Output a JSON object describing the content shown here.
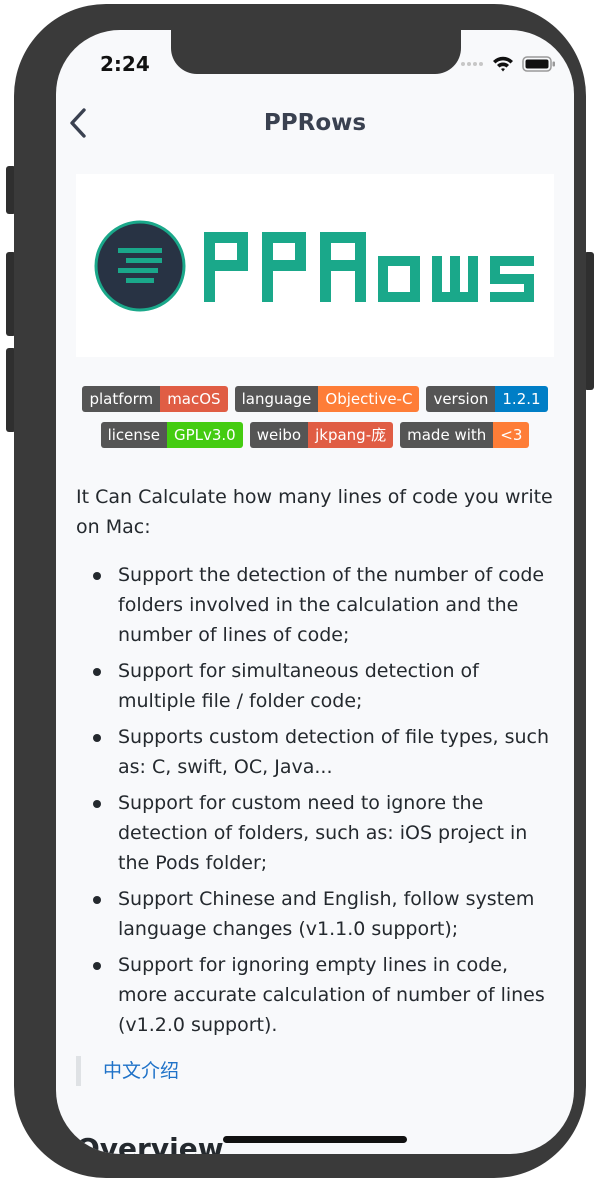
{
  "status": {
    "time": "2:24"
  },
  "nav": {
    "title": "PPRows"
  },
  "logo": {
    "text": "PPRows"
  },
  "badges_row1": [
    {
      "key": "platform",
      "value": "macOS",
      "color": "#e05d44"
    },
    {
      "key": "language",
      "value": "Objective-C",
      "color": "#fe7d37"
    },
    {
      "key": "version",
      "value": "1.2.1",
      "color": "#007ec6"
    }
  ],
  "badges_row2": [
    {
      "key": "license",
      "value": "GPLv3.0",
      "color": "#4c1"
    },
    {
      "key": "weibo",
      "value": "jkpang-庞",
      "color": "#e05d44"
    },
    {
      "key": "made with",
      "value": "<3",
      "color": "#fe7d37"
    }
  ],
  "content": {
    "intro": "It Can Calculate how many lines of code you write on Mac:",
    "features": [
      "Support the detection of the number of code folders involved in the calculation and the number of lines of code;",
      "Support for simultaneous detection of multiple file / folder code;",
      "Supports custom detection of file types, such as: C, swift, OC, Java...",
      "Support for custom need to ignore the detection of folders, such as: iOS project in the Pods folder;",
      "Support Chinese and English, follow system language changes (v1.1.0 support);",
      "Support for ignoring empty lines in code, more accurate calculation of number of lines (v1.2.0 support)."
    ],
    "chinese_link": "中文介绍",
    "overview_heading": "Overview"
  },
  "colors": {
    "logo_teal": "#1aa88a",
    "logo_dark": "#283344",
    "link": "#1f72c8"
  }
}
